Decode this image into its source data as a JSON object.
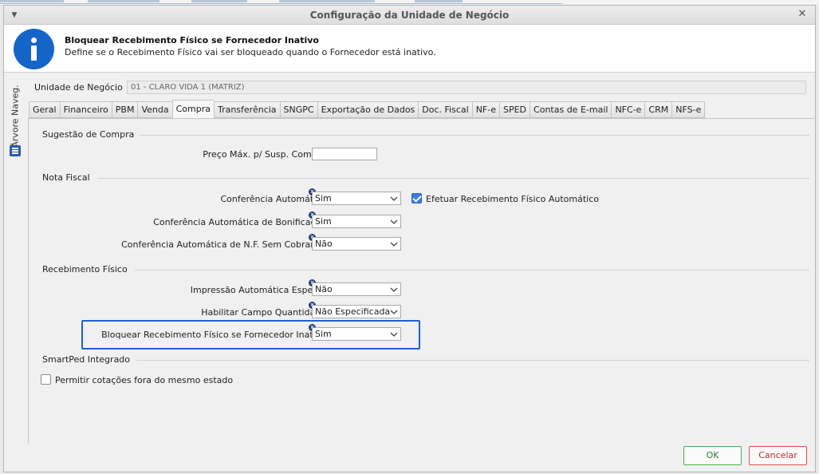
{
  "window": {
    "title": "Configuração da Unidade de Negócio"
  },
  "banner": {
    "title": "Bloquear Recebimento Físico se Fornecedor Inativo",
    "description": "Define se o Recebimento Físico vai ser bloqueado quando o Fornecedor está inativo."
  },
  "side": {
    "label": "Árvore Naveg."
  },
  "unit": {
    "label": "Unidade de Negócio",
    "value": "01 - CLARO VIDA 1 (MATRIZ)"
  },
  "tabs": [
    "Geral",
    "Financeiro",
    "PBM",
    "Venda",
    "Compra",
    "Transferência",
    "SNGPC",
    "Exportação de Dados",
    "Doc. Fiscal",
    "NF-e",
    "SPED",
    "Contas de E-mail",
    "NFC-e",
    "CRM",
    "NFS-e"
  ],
  "active_tab": "Compra",
  "sections": {
    "sugestao": {
      "title": "Sugestão de Compra",
      "preco_label": "Preço Máx. p/ Susp. Compra",
      "preco_value": ""
    },
    "nota_fiscal": {
      "title": "Nota Fiscal",
      "conf_auto_label": "Conferência Automática",
      "conf_auto_value": "Sim",
      "efetuar_label": "Efetuar Recebimento Físico Automático",
      "efetuar_checked": true,
      "conf_bonif_label": "Conferência Automática de Bonificação",
      "conf_bonif_value": "Sim",
      "conf_nf_label": "Conferência Automática de N.F. Sem Cobrança",
      "conf_nf_value": "Não"
    },
    "recebimento": {
      "title": "Recebimento Físico",
      "impressao_label": "Impressão Automática Espelho",
      "impressao_value": "Não",
      "habilitar_label": "Habilitar Campo Quantidade",
      "habilitar_value": "Não Especificada",
      "bloquear_label": "Bloquear Recebimento Físico se Fornecedor Inativo",
      "bloquear_value": "Sim"
    },
    "smartped": {
      "title": "SmartPed Integrado",
      "permitir_label": "Permitir cotações fora do mesmo estado",
      "permitir_checked": false
    }
  },
  "buttons": {
    "ok": "OK",
    "cancel": "Cancelar"
  },
  "colors": {
    "accent": "#1565c8",
    "highlight": "#1f5fcf",
    "ok": "#4caf50",
    "cancel": "#d9534f"
  }
}
